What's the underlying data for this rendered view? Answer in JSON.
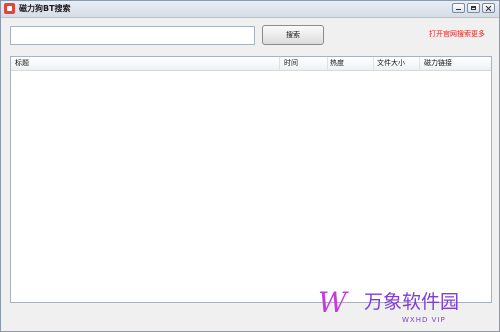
{
  "window": {
    "title": "磁力狗BT搜索"
  },
  "search": {
    "value": "",
    "placeholder": "",
    "button_label": "搜索"
  },
  "link": {
    "label": "打开官网搜索更多"
  },
  "list": {
    "columns": [
      "标题",
      "时间",
      "热度",
      "文件大小",
      "磁力链接"
    ],
    "rows": []
  },
  "watermark": {
    "logo": "W",
    "name": "万象软件园",
    "sub": "WXHD VIP"
  },
  "colors": {
    "link": "#e3211d",
    "watermark": "#7f3fd6"
  }
}
